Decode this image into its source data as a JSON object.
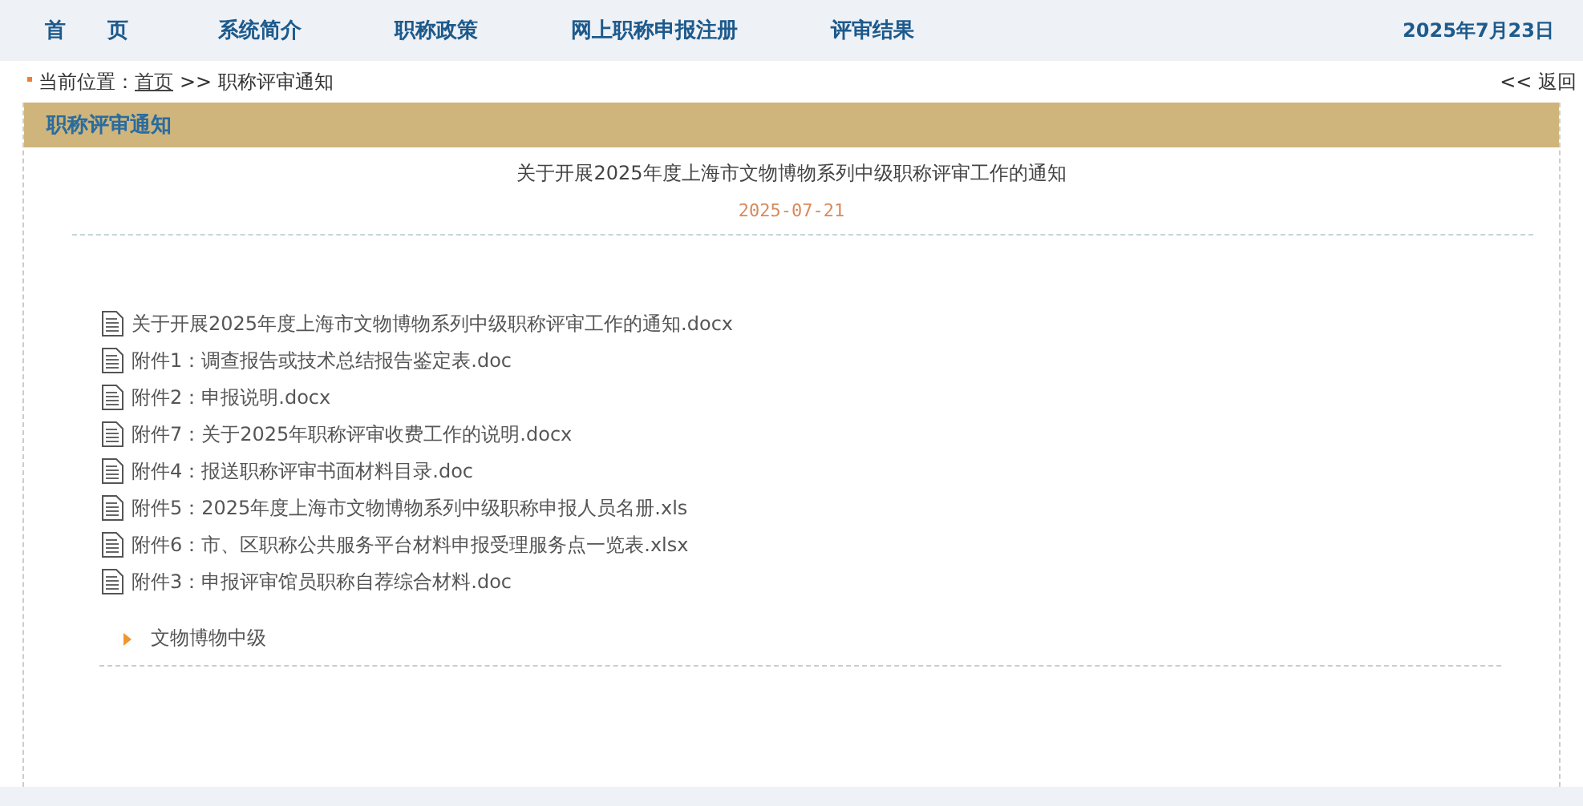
{
  "nav": {
    "items": [
      {
        "label": "首　　页"
      },
      {
        "label": "系统简介"
      },
      {
        "label": "职称政策"
      },
      {
        "label": "网上职称申报注册"
      },
      {
        "label": "评审结果"
      }
    ],
    "date": "2025年7月23日"
  },
  "breadcrumb": {
    "label": "当前位置：",
    "home": "首页",
    "separator": ">>",
    "current": "职称评审通知",
    "back": "<< 返回"
  },
  "panel": {
    "title": "职称评审通知"
  },
  "article": {
    "title": "关于开展2025年度上海市文物博物系列中级职称评审工作的通知",
    "date": "2025-07-21",
    "attachments": [
      {
        "name": "关于开展2025年度上海市文物博物系列中级职称评审工作的通知.docx"
      },
      {
        "name": "附件1：调查报告或技术总结报告鉴定表.doc"
      },
      {
        "name": "附件2：申报说明.docx"
      },
      {
        "name": "附件7：关于2025年职称评审收费工作的说明.docx"
      },
      {
        "name": "附件4：报送职称评审书面材料目录.doc"
      },
      {
        "name": "附件5：2025年度上海市文物博物系列中级职称申报人员名册.xls"
      },
      {
        "name": "附件6：市、区职称公共服务平台材料申报受理服务点一览表.xlsx"
      },
      {
        "name": "附件3：申报评审馆员职称自荐综合材料.doc"
      }
    ],
    "category": "文物博物中级"
  }
}
